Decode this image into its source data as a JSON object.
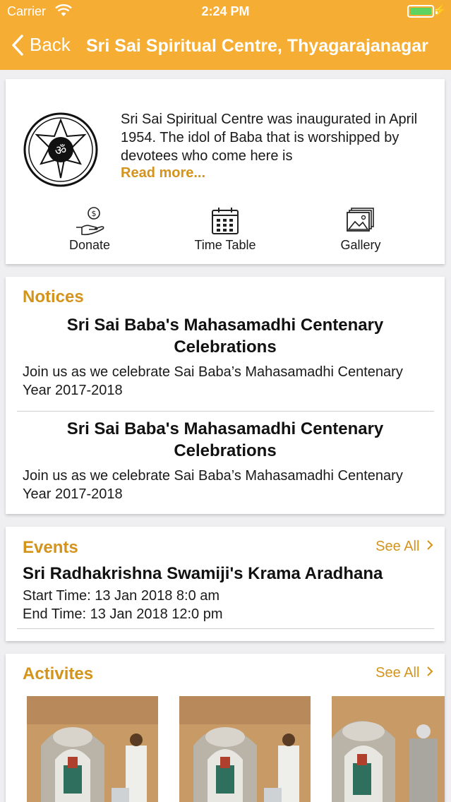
{
  "status_bar": {
    "carrier": "Carrier",
    "time": "2:24 PM"
  },
  "nav": {
    "back_label": "Back",
    "title": "Sri Sai Spiritual Centre, Thyagarajanagar"
  },
  "about": {
    "text": "Sri Sai Spiritual Centre was inaugurated in April 1954. The idol of Baba that is worshipped by devotees who come here is",
    "read_more": "Read more...",
    "actions": [
      {
        "label": "Donate",
        "icon": "donate-icon"
      },
      {
        "label": "Time Table",
        "icon": "calendar-icon"
      },
      {
        "label": "Gallery",
        "icon": "gallery-icon"
      }
    ]
  },
  "notices": {
    "title": "Notices",
    "items": [
      {
        "title": "Sri Sai Baba's Mahasamadhi Centenary Celebrations",
        "body": "Join us as we celebrate Sai Baba’s Mahasamadhi Centenary Year 2017-2018"
      },
      {
        "title": "Sri Sai Baba's Mahasamadhi Centenary Celebrations",
        "body": "Join us as we celebrate Sai Baba’s Mahasamadhi Centenary Year 2017-2018"
      }
    ]
  },
  "events": {
    "title": "Events",
    "see_all": "See All",
    "items": [
      {
        "title": "Sri Radhakrishna Swamiji's Krama Aradhana",
        "start": "Start Time: 13 Jan 2018 8:0 am",
        "end": "End Time: 13 Jan 2018 12:0 pm"
      }
    ]
  },
  "activities": {
    "title": "Activites",
    "see_all": "See All",
    "thumbnails": [
      "activity-photo",
      "activity-photo",
      "activity-photo"
    ]
  },
  "colors": {
    "accent": "#f6ad33",
    "section_title": "#d4941c"
  }
}
